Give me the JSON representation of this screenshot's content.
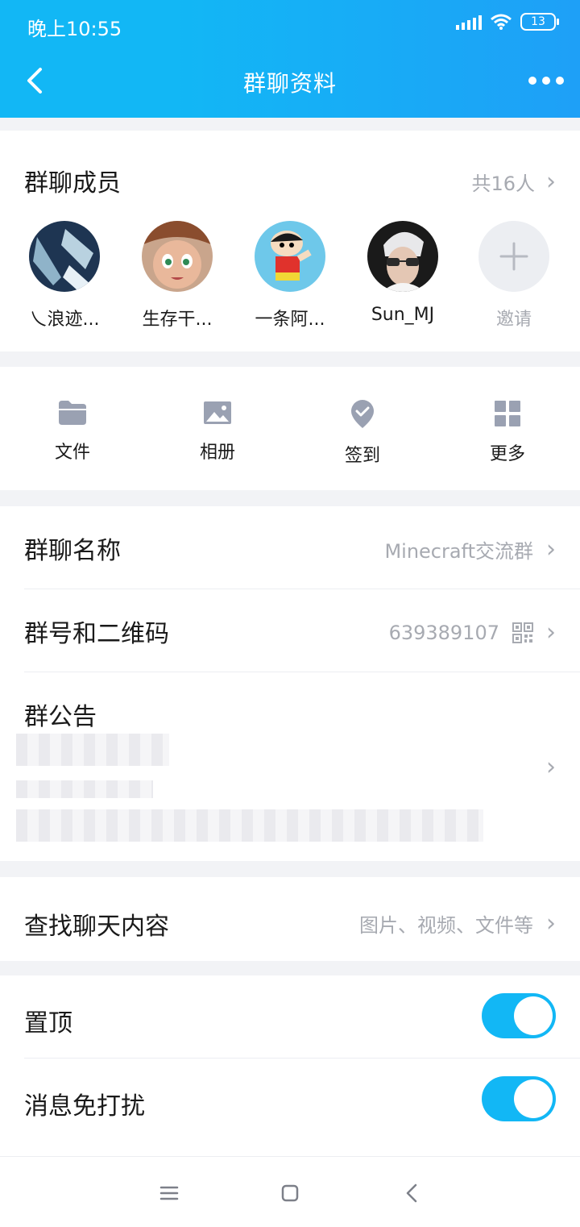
{
  "status_bar": {
    "time": "晚上10:55",
    "battery": "13"
  },
  "header": {
    "title": "群聊资料"
  },
  "members": {
    "title": "群聊成员",
    "count": "共16人",
    "list": [
      {
        "name": "乀浪迹..."
      },
      {
        "name": "生存干..."
      },
      {
        "name": "一条阿..."
      },
      {
        "name": "Sun_MJ"
      }
    ],
    "invite_label": "邀请"
  },
  "tools": [
    {
      "label": "文件",
      "icon": "folder-icon"
    },
    {
      "label": "相册",
      "icon": "image-icon"
    },
    {
      "label": "签到",
      "icon": "checkin-icon"
    },
    {
      "label": "更多",
      "icon": "grid-icon"
    }
  ],
  "group_name": {
    "label": "群聊名称",
    "value": "Minecraft交流群"
  },
  "group_id": {
    "label": "群号和二维码",
    "value": "639389107"
  },
  "notice": {
    "label": "群公告"
  },
  "search_chat": {
    "label": "查找聊天内容",
    "value": "图片、视频、文件等"
  },
  "pin": {
    "label": "置顶",
    "on": true
  },
  "mute": {
    "label": "消息免打扰",
    "on": true
  },
  "colors": {
    "accent": "#12b7f5",
    "muted_text": "#a7aab1",
    "background": "#f2f3f6"
  }
}
